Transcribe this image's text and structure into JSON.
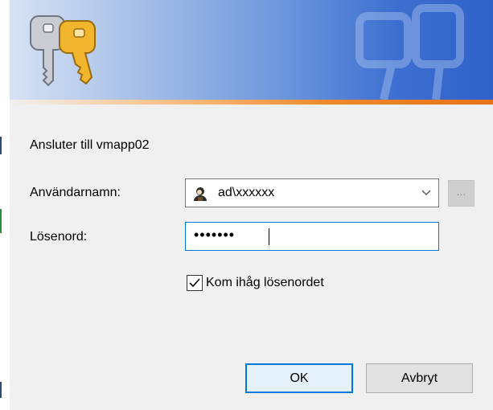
{
  "dialog": {
    "connecting_text": "Ansluter till vmapp02",
    "username_label": "Användarnamn:",
    "username_value": "ad\\xxxxxx",
    "browse_label": "...",
    "password_label": "Lösenord:",
    "password_mask": "•••••••",
    "remember_label": "Kom ihåg lösenordet",
    "remember_checked": true,
    "ok_label": "OK",
    "cancel_label": "Avbryt"
  },
  "colors": {
    "accent": "#0078d7",
    "banner_blue": "#3d6fd0",
    "banner_orange": "#e87217"
  },
  "icons": {
    "banner": "keys-icon",
    "user": "user-icon",
    "dropdown": "chevron-down-icon",
    "checkbox": "checkmark-icon"
  }
}
